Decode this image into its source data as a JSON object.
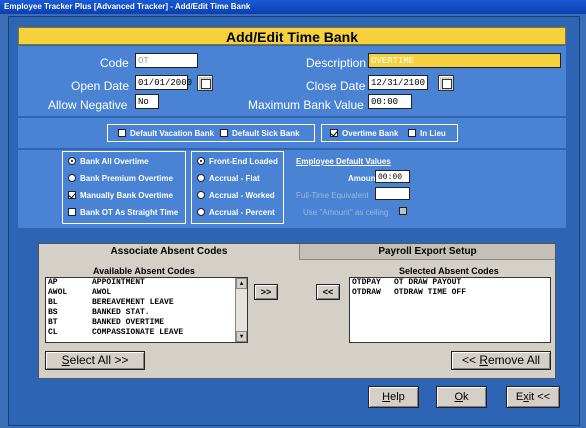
{
  "window": {
    "title": "Employee Tracker Plus [Advanced Tracker] - Add/Edit Time Bank"
  },
  "header": {
    "title": "Add/Edit Time Bank"
  },
  "form": {
    "code_label": "Code",
    "code_value": "OT",
    "description_label": "Description",
    "description_value": "OVERTIME",
    "open_date_label": "Open Date",
    "open_date_value": "01/01/2000",
    "close_date_label": "Close Date",
    "close_date_value": "12/31/2100",
    "allow_negative_label": "Allow Negative",
    "allow_negative_value": "No",
    "max_bank_label": "Maximum Bank Value",
    "max_bank_value": "00:00"
  },
  "flags": {
    "default_vacation": {
      "label": "Default Vacation Bank",
      "checked": false
    },
    "default_sick": {
      "label": "Default Sick Bank",
      "checked": false
    },
    "overtime_bank": {
      "label": "Overtime Bank",
      "checked": true
    },
    "in_lieu": {
      "label": "In Lieu",
      "checked": false
    }
  },
  "bank_options": [
    {
      "type": "radio",
      "label": "Bank All Overtime",
      "checked": true
    },
    {
      "type": "radio",
      "label": "Bank Premium Overtime",
      "checked": false
    },
    {
      "type": "check",
      "label": "Manually Bank Overtime",
      "checked": true
    },
    {
      "type": "check",
      "label": "Bank OT As Straight Time",
      "checked": false
    }
  ],
  "accrual_options": [
    {
      "label": "Front-End Loaded",
      "checked": true
    },
    {
      "label": "Accrual - Flat",
      "checked": false
    },
    {
      "label": "Accrual - Worked",
      "checked": false
    },
    {
      "label": "Accrual - Percent",
      "checked": false
    }
  ],
  "employee_defaults": {
    "title": "Employee Default Values",
    "amount_label": "Amount",
    "amount_value": "00:00",
    "fte_label": "Full-Time Equivalent",
    "use_amount_label": "Use \"Amount\" as ceiling"
  },
  "tabs": {
    "associate": "Associate Absent Codes",
    "payroll": "Payroll Export Setup"
  },
  "available": {
    "title": "Available Absent Codes",
    "items": [
      {
        "code": "AP",
        "desc": "APPOINTMENT"
      },
      {
        "code": "AWOL",
        "desc": "AWOL"
      },
      {
        "code": "BL",
        "desc": "BEREAVEMENT LEAVE"
      },
      {
        "code": "BS",
        "desc": "BANKED STAT."
      },
      {
        "code": "BT",
        "desc": "BANKED OVERTIME"
      },
      {
        "code": "CL",
        "desc": "COMPASSIONATE LEAVE"
      }
    ]
  },
  "selected": {
    "title": "Selected Absent Codes",
    "items": [
      {
        "code": "OTDPAY",
        "desc": "OT DRAW PAYOUT"
      },
      {
        "code": "OTDRAW",
        "desc": "OTDRAW TIME OFF"
      }
    ]
  },
  "buttons": {
    "move_right": ">>",
    "move_left": "<<",
    "select_all_u": "S",
    "select_all_rest": "elect All >>",
    "remove_all_pre": "<< ",
    "remove_all_u": "R",
    "remove_all_rest": "emove All",
    "help_u": "H",
    "help_rest": "elp",
    "ok_u": "O",
    "ok_rest": "k",
    "exit_pre": "E",
    "exit_u": "x",
    "exit_rest": "it <<"
  },
  "colors": {
    "accent": "#f5d23d",
    "panel": "#4a83d4",
    "frame": "#2d64b3",
    "titlebar": "#0a3fb0"
  }
}
